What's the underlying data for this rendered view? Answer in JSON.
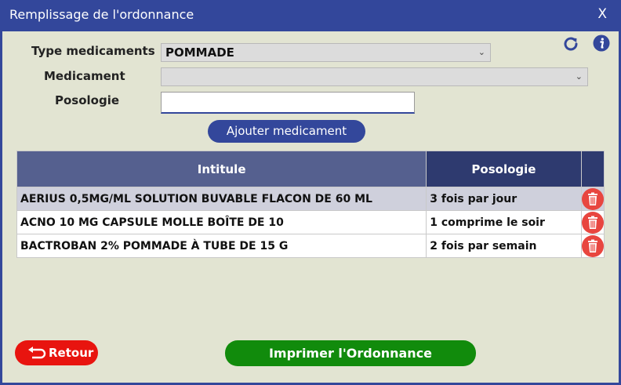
{
  "window": {
    "title": "Remplissage de l'ordonnance",
    "close_label": "X"
  },
  "icons": {
    "refresh": "refresh-icon",
    "info": "info-icon",
    "delete": "trash-icon",
    "back": "back-arrow-icon"
  },
  "colors": {
    "primary": "#33479b",
    "danger": "#e8140f",
    "success": "#118b0c",
    "background": "#e2e4d2"
  },
  "form": {
    "type_label": "Type medicaments",
    "type_value": "POMMADE",
    "medicament_label": "Medicament",
    "medicament_value": "",
    "posologie_label": "Posologie",
    "posologie_value": "",
    "add_button": "Ajouter medicament"
  },
  "table": {
    "headers": [
      "Intitule",
      "Posologie",
      ""
    ],
    "rows": [
      {
        "intitule": "AERIUS 0,5MG/ML SOLUTION BUVABLE FLACON DE 60 ML",
        "posologie": "3 fois par jour"
      },
      {
        "intitule": "ACNO 10 MG CAPSULE MOLLE BOÎTE DE 10",
        "posologie": "1 comprime le soir"
      },
      {
        "intitule": "BACTROBAN 2% POMMADE À TUBE DE 15 G",
        "posologie": "2 fois par semain"
      }
    ]
  },
  "footer": {
    "back_button": "Retour",
    "print_button": "Imprimer l'Ordonnance"
  }
}
